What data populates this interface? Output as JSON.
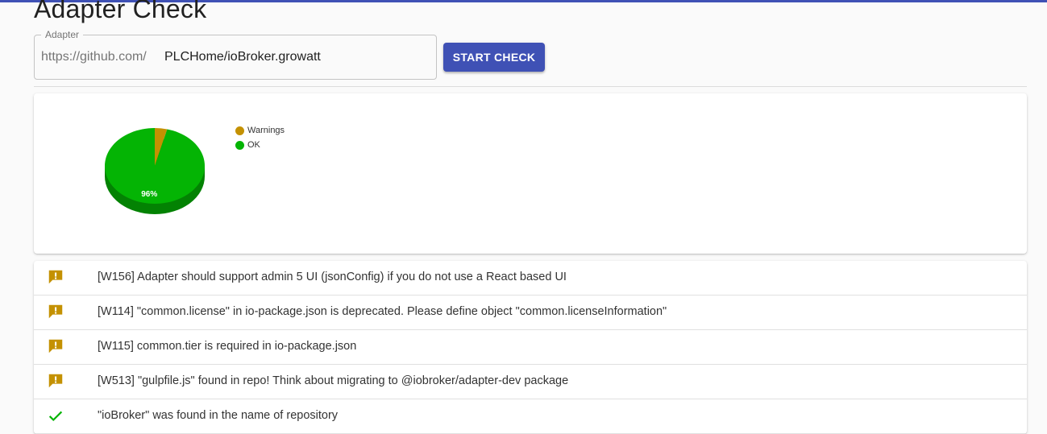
{
  "page": {
    "title": "Adapter Check"
  },
  "adapter_field": {
    "legend": "Adapter",
    "prefix": "https://github.com/",
    "value": "PLCHome/ioBroker.growatt"
  },
  "actions": {
    "start_check_label": "START CHECK"
  },
  "colors": {
    "accent": "#3f51b5",
    "warning": "#c49102",
    "ok": "#04b404"
  },
  "chart_data": {
    "type": "pie",
    "categories": [
      "Warnings",
      "OK"
    ],
    "values": [
      4,
      96
    ],
    "data_labels": [
      "",
      "96%"
    ],
    "legend_position": "right",
    "colors": [
      "#c49102",
      "#04b404"
    ]
  },
  "results": [
    {
      "icon": "warning-icon",
      "status": "warning",
      "text": "[W156] Adapter should support admin 5 UI (jsonConfig) if you do not use a React based UI"
    },
    {
      "icon": "warning-icon",
      "status": "warning",
      "text": "[W114] \"common.license\" in io-package.json is deprecated. Please define object \"common.licenseInformation\""
    },
    {
      "icon": "warning-icon",
      "status": "warning",
      "text": "[W115] common.tier is required in io-package.json"
    },
    {
      "icon": "warning-icon",
      "status": "warning",
      "text": "[W513] \"gulpfile.js\" found in repo! Think about migrating to @iobroker/adapter-dev package"
    },
    {
      "icon": "check-icon",
      "status": "ok",
      "text": "\"ioBroker\" was found in the name of repository"
    }
  ]
}
